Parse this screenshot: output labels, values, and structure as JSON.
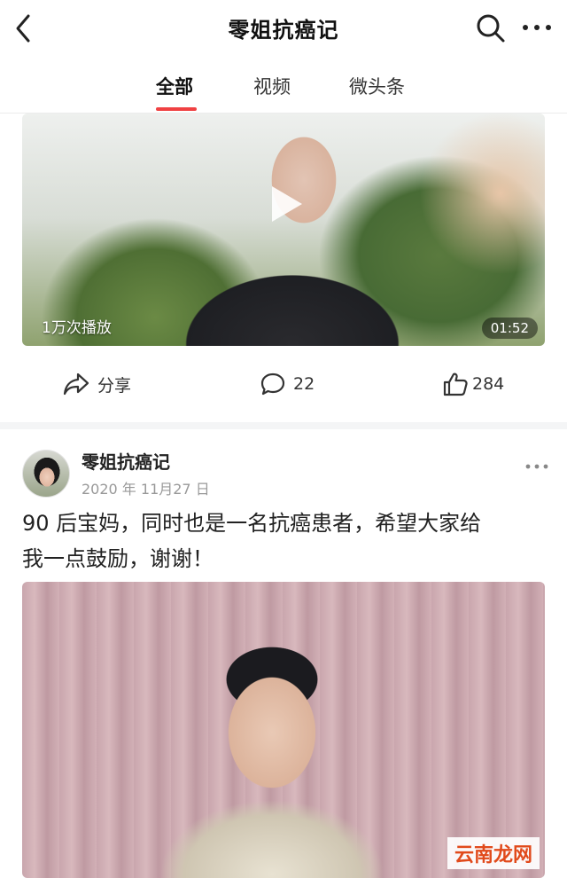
{
  "header": {
    "title": "零姐抗癌记",
    "back_icon": "chevron-left-icon",
    "search_icon": "search-icon",
    "more_icon": "more-horizontal-icon"
  },
  "tabs": [
    {
      "label": "全部",
      "active": true
    },
    {
      "label": "视频",
      "active": false
    },
    {
      "label": "微头条",
      "active": false
    }
  ],
  "accent_color": "#f04142",
  "video1": {
    "views": "1万次播放",
    "duration": "01:52"
  },
  "actions": {
    "share_label": "分享",
    "comments": "22",
    "likes": "284"
  },
  "post": {
    "author": "零姐抗癌记",
    "date": "2020 年 11月27 日",
    "text_line1": "90 后宝妈，同时也是一名抗癌患者，希望大家给",
    "text_line2": "我一点鼓励，谢谢！"
  },
  "watermark": "云南龙网"
}
